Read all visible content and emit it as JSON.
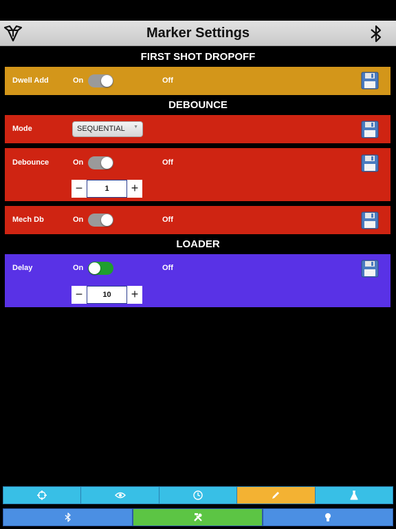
{
  "header": {
    "title": "Marker Settings",
    "logo_icon": "rune-logo-icon",
    "bluetooth_icon": "bluetooth-icon"
  },
  "sections": {
    "first_shot_dropoff": "FIRST SHOT DROPOFF",
    "debounce": "DEBOUNCE",
    "loader": "LOADER"
  },
  "colors": {
    "orange_panel": "#d3961a",
    "red_panel": "#cf2412",
    "purple_panel": "#5932e6",
    "active_tab": "#f3b233"
  },
  "dwell_add": {
    "label": "Dwell Add",
    "on_label": "On",
    "off_label": "Off",
    "state": "on"
  },
  "mode": {
    "label": "Mode",
    "selected": "SEQUENTIAL"
  },
  "debounce": {
    "label": "Debounce",
    "on_label": "On",
    "off_label": "Off",
    "state": "on",
    "value": "1",
    "minus": "−",
    "plus": "+"
  },
  "mech_db": {
    "label": "Mech Db",
    "on_label": "On",
    "off_label": "Off",
    "state": "on"
  },
  "delay": {
    "label": "Delay",
    "on_label": "On",
    "off_label": "Off",
    "state": "off",
    "value": "10",
    "minus": "−",
    "plus": "+"
  },
  "tabs_top": [
    {
      "icon": "crosshair-icon",
      "active": false
    },
    {
      "icon": "eye-icon",
      "active": false
    },
    {
      "icon": "clock-icon",
      "active": false
    },
    {
      "icon": "pencil-icon",
      "active": true
    },
    {
      "icon": "flask-icon",
      "active": false
    }
  ],
  "tabs_bottom": [
    {
      "icon": "bluetooth-icon",
      "active": false
    },
    {
      "icon": "tools-icon",
      "active": true
    },
    {
      "icon": "lightbulb-icon",
      "active": false
    }
  ]
}
